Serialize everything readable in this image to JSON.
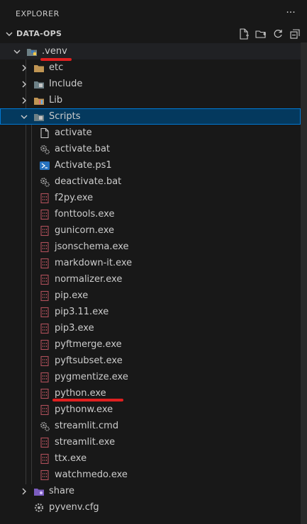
{
  "header": {
    "title": "EXPLORER",
    "more_icon": "ellipsis-icon"
  },
  "section": {
    "name": "DATA-OPS",
    "actions": [
      "new-file-icon",
      "new-folder-icon",
      "refresh-icon",
      "collapse-all-icon"
    ]
  },
  "tree": {
    "venv": ".venv",
    "folders": [
      {
        "label": "etc"
      },
      {
        "label": "Include"
      },
      {
        "label": "Lib"
      },
      {
        "label": "Scripts"
      }
    ],
    "scripts": [
      {
        "label": "activate"
      },
      {
        "label": "activate.bat"
      },
      {
        "label": "Activate.ps1"
      },
      {
        "label": "deactivate.bat"
      },
      {
        "label": "f2py.exe"
      },
      {
        "label": "fonttools.exe"
      },
      {
        "label": "gunicorn.exe"
      },
      {
        "label": "jsonschema.exe"
      },
      {
        "label": "markdown-it.exe"
      },
      {
        "label": "normalizer.exe"
      },
      {
        "label": "pip.exe"
      },
      {
        "label": "pip3.11.exe"
      },
      {
        "label": "pip3.exe"
      },
      {
        "label": "pyftmerge.exe"
      },
      {
        "label": "pyftsubset.exe"
      },
      {
        "label": "pygmentize.exe"
      },
      {
        "label": "python.exe"
      },
      {
        "label": "pythonw.exe"
      },
      {
        "label": "streamlit.cmd"
      },
      {
        "label": "streamlit.exe"
      },
      {
        "label": "ttx.exe"
      },
      {
        "label": "watchmedo.exe"
      }
    ],
    "after": [
      {
        "label": "share"
      },
      {
        "label": "pyvenv.cfg"
      }
    ]
  },
  "colors": {
    "selection": "#04395e",
    "focus": "#0078d4",
    "annotation": "#e02020"
  }
}
